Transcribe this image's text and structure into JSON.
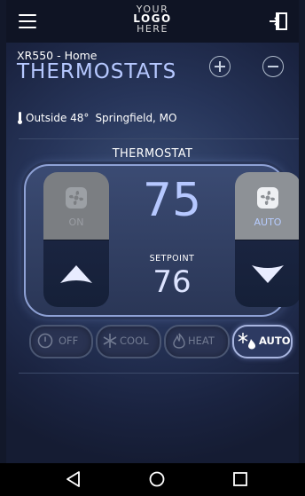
{
  "header": {
    "logo_line1": "YOUR",
    "logo_line2": "LOGO",
    "logo_line3": "HERE",
    "menu_icon": "hamburger-icon",
    "logout_icon": "logout-icon"
  },
  "page": {
    "subtitle": "XR550 - Home",
    "title": "THERMOSTATS",
    "add_icon": "plus-circle-icon",
    "remove_icon": "minus-circle-icon"
  },
  "weather": {
    "text": "Outside 48°",
    "location": "Springfield, MO"
  },
  "thermostat": {
    "name": "THERMOSTAT",
    "current_temp": "75",
    "setpoint_label": "SETPOINT",
    "setpoint": "76",
    "fan_left_label": "ON",
    "fan_right_label": "AUTO"
  },
  "modes": [
    {
      "label": "OFF",
      "icon": "power-icon",
      "active": false
    },
    {
      "label": "COOL",
      "icon": "snowflake-icon",
      "active": false
    },
    {
      "label": "HEAT",
      "icon": "flame-icon",
      "active": false
    },
    {
      "label": "AUTO",
      "icon": "auto-icon",
      "active": true
    }
  ],
  "colors": {
    "accent": "#b6c8ff",
    "background": "#27355a",
    "topbar": "#0f1424"
  },
  "navbar": {
    "back_icon": "back-triangle-icon",
    "home_icon": "home-circle-icon",
    "recents_icon": "recents-square-icon"
  }
}
